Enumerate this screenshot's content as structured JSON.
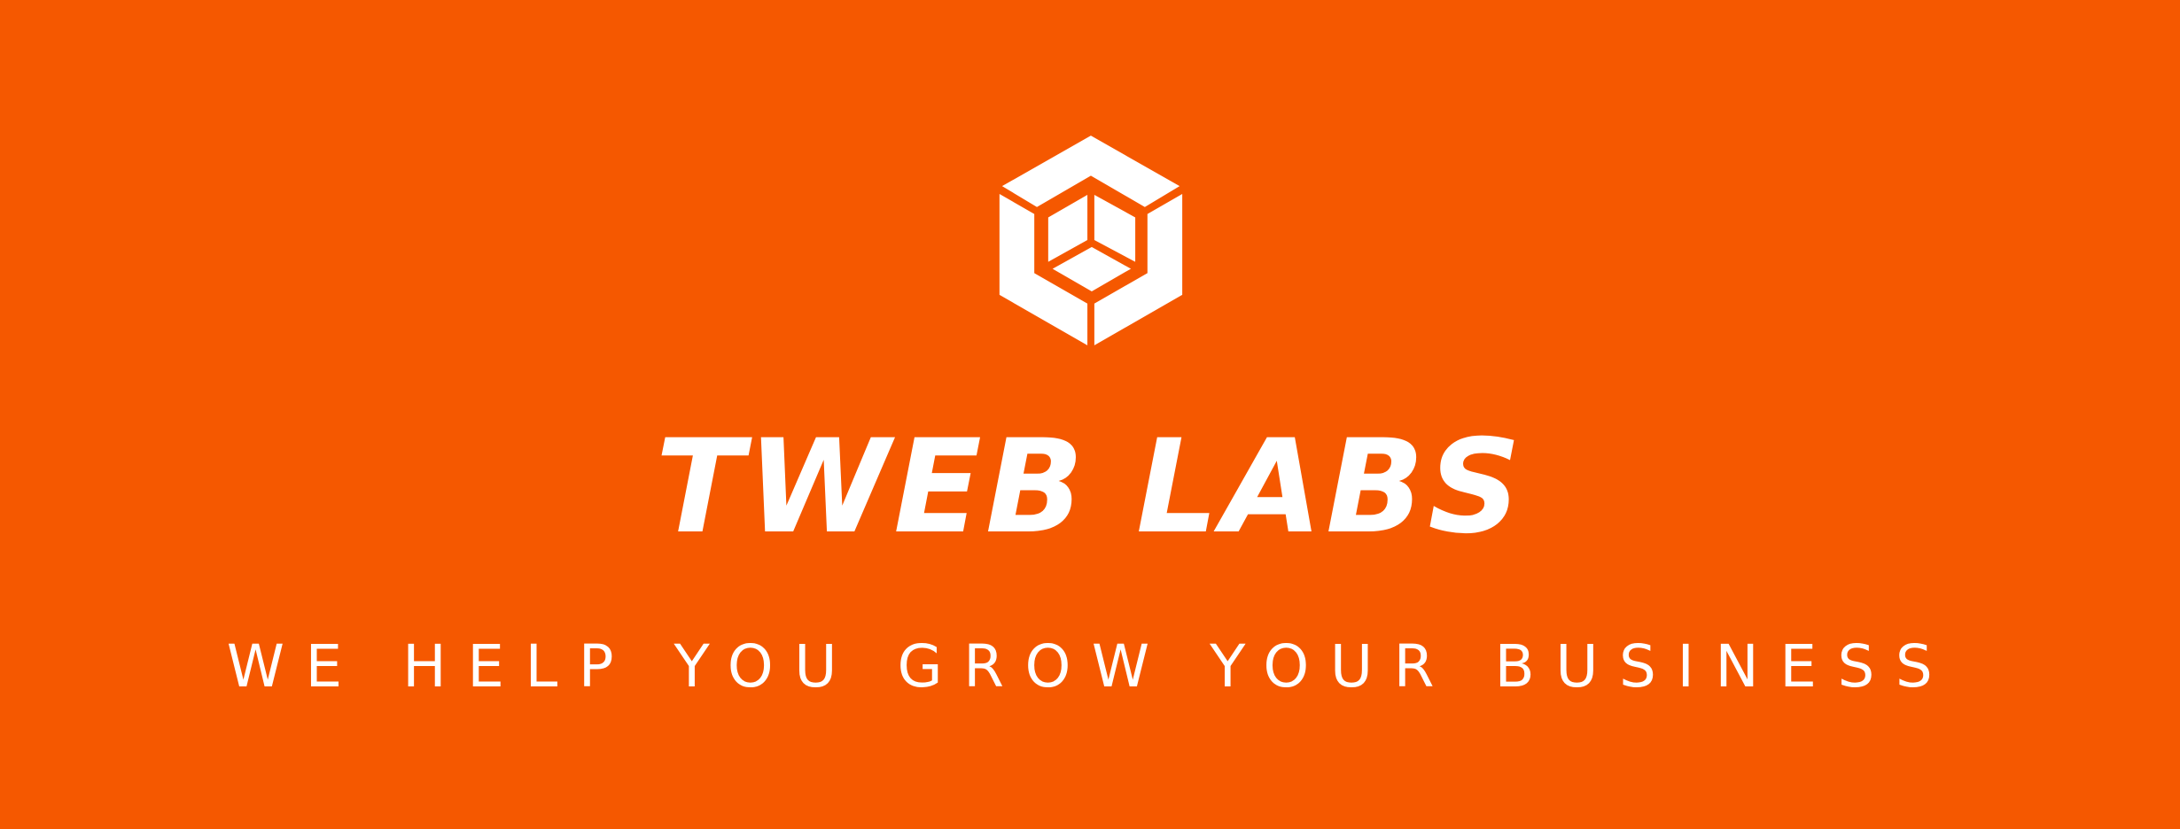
{
  "colors": {
    "background": "#F55800",
    "foreground": "#FFFFFF"
  },
  "logo": {
    "icon": "hexagonal-cube-logo-icon"
  },
  "brand": {
    "name": "TWEB LABS"
  },
  "tagline": {
    "text": "WE HELP YOU GROW YOUR BUSINESS"
  }
}
